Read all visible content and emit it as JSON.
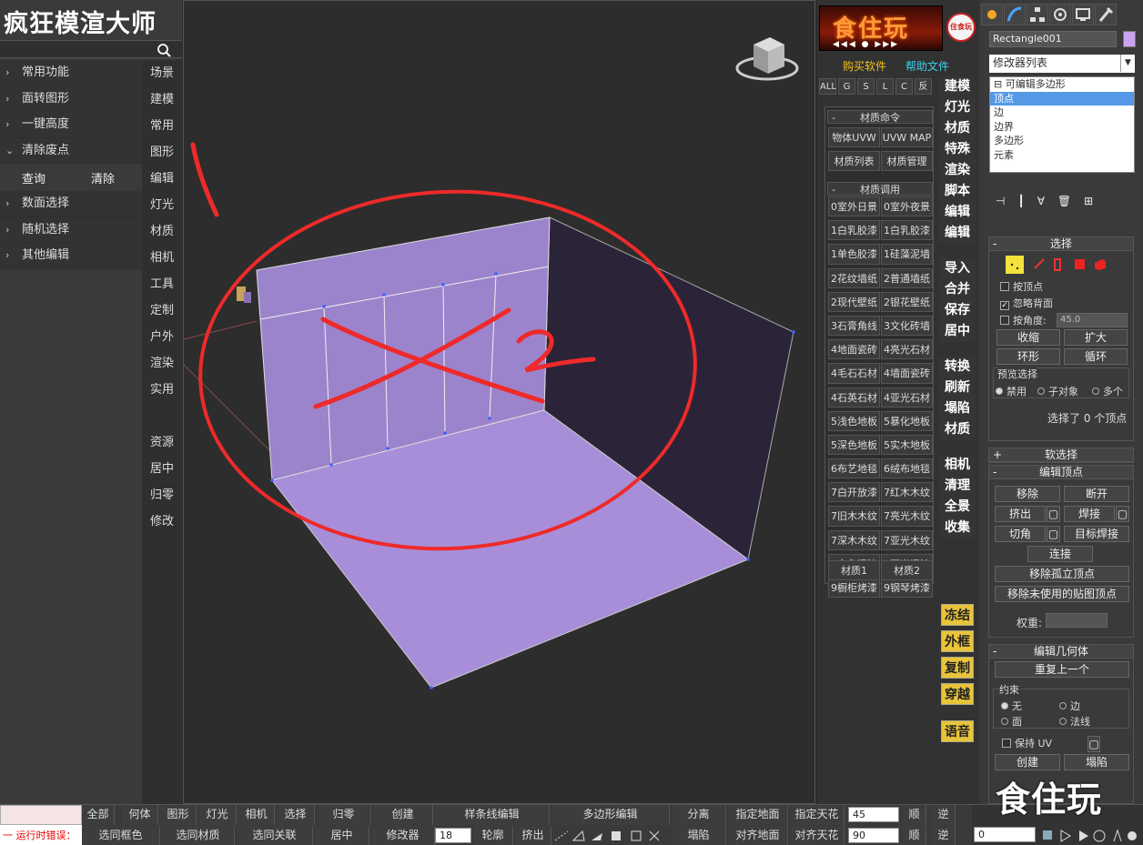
{
  "app": {
    "title": "疯狂模渲大师"
  },
  "left_menu": {
    "items_top": [
      {
        "label": "常用功能",
        "chevron": "›"
      },
      {
        "label": "面转图形",
        "chevron": "›"
      },
      {
        "label": "一键高度",
        "chevron": "›"
      },
      {
        "label": "清除废点",
        "chevron": "⌄"
      }
    ],
    "sub_actions": {
      "query": "查询",
      "clear": "清除"
    },
    "items_bottom": [
      {
        "label": "数面选择",
        "chevron": "›"
      },
      {
        "label": "随机选择",
        "chevron": "›"
      },
      {
        "label": "其他编辑",
        "chevron": "›"
      }
    ],
    "categories": [
      "场景",
      "建模",
      "常用",
      "图形",
      "编辑",
      "灯光",
      "材质",
      "相机",
      "工具",
      "定制",
      "户外",
      "渲染",
      "实用",
      "",
      "资源",
      "居中",
      "归零",
      "修改"
    ]
  },
  "banner": {
    "text": "食住玩",
    "controls": "◀◀◀   ●   ▶▶▶",
    "logo_text": "住食玩"
  },
  "mid_links": {
    "buy": "购买软件",
    "help": "帮助文件"
  },
  "filters": [
    "ALL",
    "G",
    "S",
    "L",
    "C",
    "反"
  ],
  "material_panel": {
    "cmd_title": "材质命令",
    "cmd_buttons": [
      "物体UVW",
      "UVW MAP",
      "材质列表",
      "材质管理"
    ],
    "use_title": "材质调用",
    "use_buttons": [
      "0室外日景",
      "0室外夜景",
      "1白乳胶漆",
      "1白乳胶漆",
      "1单色胶漆",
      "1硅藻泥墙",
      "2花纹墙纸",
      "2普通墙纸",
      "2现代壁纸",
      "2银花壁纸",
      "3石膏角线",
      "3文化砖墙",
      "4地面瓷砖",
      "4亮光石材",
      "4毛石石材",
      "4墙面瓷砖",
      "4石英石材",
      "4亚光石材",
      "5浅色地板",
      "5暴化地板",
      "5深色地板",
      "5实木地板",
      "6布艺地毯",
      "6绒布地毯",
      "7白开放漆",
      "7红木木纹",
      "7旧木木纹",
      "7亮光木纹",
      "7深木木纹",
      "7亚光木纹",
      "8白色混油",
      "8亚光混油",
      "9橱柜烤漆",
      "9钢琴烤漆"
    ],
    "foot_buttons": [
      "材质1",
      "材质2"
    ]
  },
  "actions": {
    "group1": [
      "建模",
      "灯光",
      "材质",
      "特殊",
      "渲染",
      "脚本",
      "编辑",
      "编辑"
    ],
    "group2": [
      "导入",
      "合并",
      "保存",
      "居中"
    ],
    "group3": [
      "转换",
      "刷新",
      "塌陷",
      "材质"
    ],
    "group4": [
      "相机",
      "清理",
      "全景",
      "收集"
    ],
    "yellow": [
      "冻结",
      "外框",
      "复制",
      "穿越"
    ],
    "voice": "语音"
  },
  "command_panel": {
    "object_name": "Rectangle001",
    "object_color": "#c9a3f0",
    "modifier_list": "修改器列表",
    "stack": [
      {
        "label": "⊟ 可编辑多边形",
        "selected": false
      },
      {
        "label": "      顶点",
        "selected": true
      },
      {
        "label": "      边",
        "selected": false
      },
      {
        "label": "      边界",
        "selected": false
      },
      {
        "label": "      多边形",
        "selected": false
      },
      {
        "label": "      元素",
        "selected": false
      }
    ],
    "select": {
      "title": "选择",
      "by_vertex": "按顶点",
      "ignore_backface": "忽略背面",
      "by_angle": "按角度:",
      "angle_value": "45.0",
      "shrink": "收缩",
      "grow": "扩大",
      "ring": "环形",
      "loop": "循环",
      "preview_title": "预览选择",
      "preview_options": [
        "禁用",
        "子对象",
        "多个"
      ],
      "status": "选择了 0 个顶点"
    },
    "soft_select": "软选择",
    "edit_vertices": {
      "title": "编辑顶点",
      "remove": "移除",
      "break": "断开",
      "extrude": "挤出",
      "weld": "焊接",
      "chamfer": "切角",
      "target_weld": "目标焊接",
      "connect": "连接",
      "remove_isolated": "移除孤立顶点",
      "remove_unused_map": "移除未使用的贴图顶点",
      "weight_label": "权重:"
    },
    "edit_geometry": {
      "title": "编辑几何体",
      "repeat_last": "重复上一个",
      "constraints": "约束",
      "c_none": "无",
      "c_edge": "边",
      "c_face": "面",
      "c_normal": "法线",
      "preserve_uv": "保持 UV",
      "create": "创建",
      "collapse": "塌陷"
    }
  },
  "bottom": {
    "error_label": "一 运行时错误：",
    "row1": [
      "全部",
      "何体",
      "图形",
      "灯光",
      "相机",
      "选择",
      "归零",
      "创建",
      "样条线编辑",
      "多边形编辑",
      "分离",
      "指定地面",
      "指定天花"
    ],
    "row2": [
      "选同框色",
      "选同材质",
      "选同关联",
      "居中",
      "修改器",
      "轮廓",
      "挤出",
      "塌陷",
      "对齐地面",
      "对齐天花"
    ],
    "field1": "45",
    "field2": "90",
    "field3": "18",
    "shun": "顺",
    "ni": "逆",
    "nav_value": "0"
  },
  "annotations": {
    "one": "1",
    "two": "2"
  },
  "watermark": "食住玩"
}
